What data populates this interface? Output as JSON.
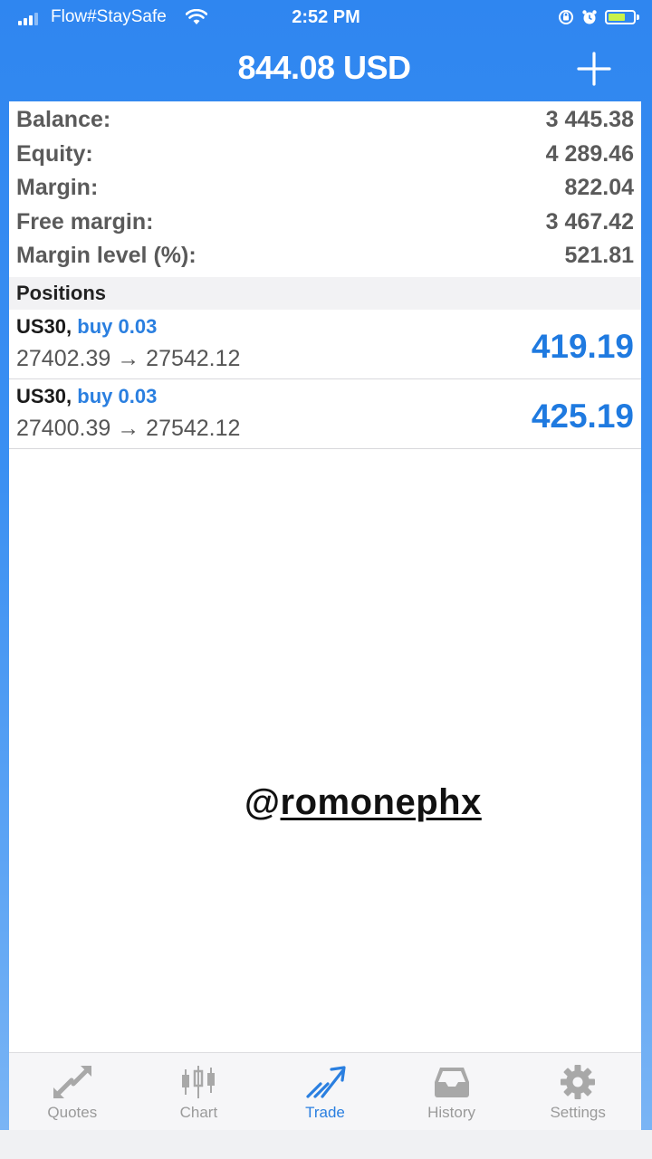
{
  "status_bar": {
    "carrier": "Flow#StaySafe",
    "time": "2:52 PM",
    "battery_fill_fraction": 0.7
  },
  "nav": {
    "title": "844.08 USD",
    "add_icon": "plus-icon"
  },
  "account": {
    "rows": [
      {
        "label": "Balance:",
        "value": "3 445.38"
      },
      {
        "label": "Equity:",
        "value": "4 289.46"
      },
      {
        "label": "Margin:",
        "value": "822.04"
      },
      {
        "label": "Free margin:",
        "value": "3 467.42"
      },
      {
        "label": "Margin level (%):",
        "value": "521.81"
      }
    ]
  },
  "positions": {
    "header": "Positions",
    "items": [
      {
        "symbol": "US30,",
        "side": "buy 0.03",
        "prices": "27402.39 → 27542.12",
        "profit": "419.19"
      },
      {
        "symbol": "US30,",
        "side": "buy 0.03",
        "prices": "27400.39 → 27542.12",
        "profit": "425.19"
      }
    ]
  },
  "watermark": {
    "at": "@",
    "handle": "romonephx"
  },
  "tabs": [
    {
      "label": "Quotes",
      "icon": "quotes-arrows-icon"
    },
    {
      "label": "Chart",
      "icon": "candlestick-chart-icon"
    },
    {
      "label": "Trade",
      "icon": "trade-trend-icon",
      "active": true
    },
    {
      "label": "History",
      "icon": "inbox-tray-icon"
    },
    {
      "label": "Settings",
      "icon": "gear-icon"
    }
  ],
  "colors": {
    "accent_blue": "#2a7fe0",
    "nav_blue": "#2f86f0",
    "inactive_gray": "#9a9a9a"
  }
}
